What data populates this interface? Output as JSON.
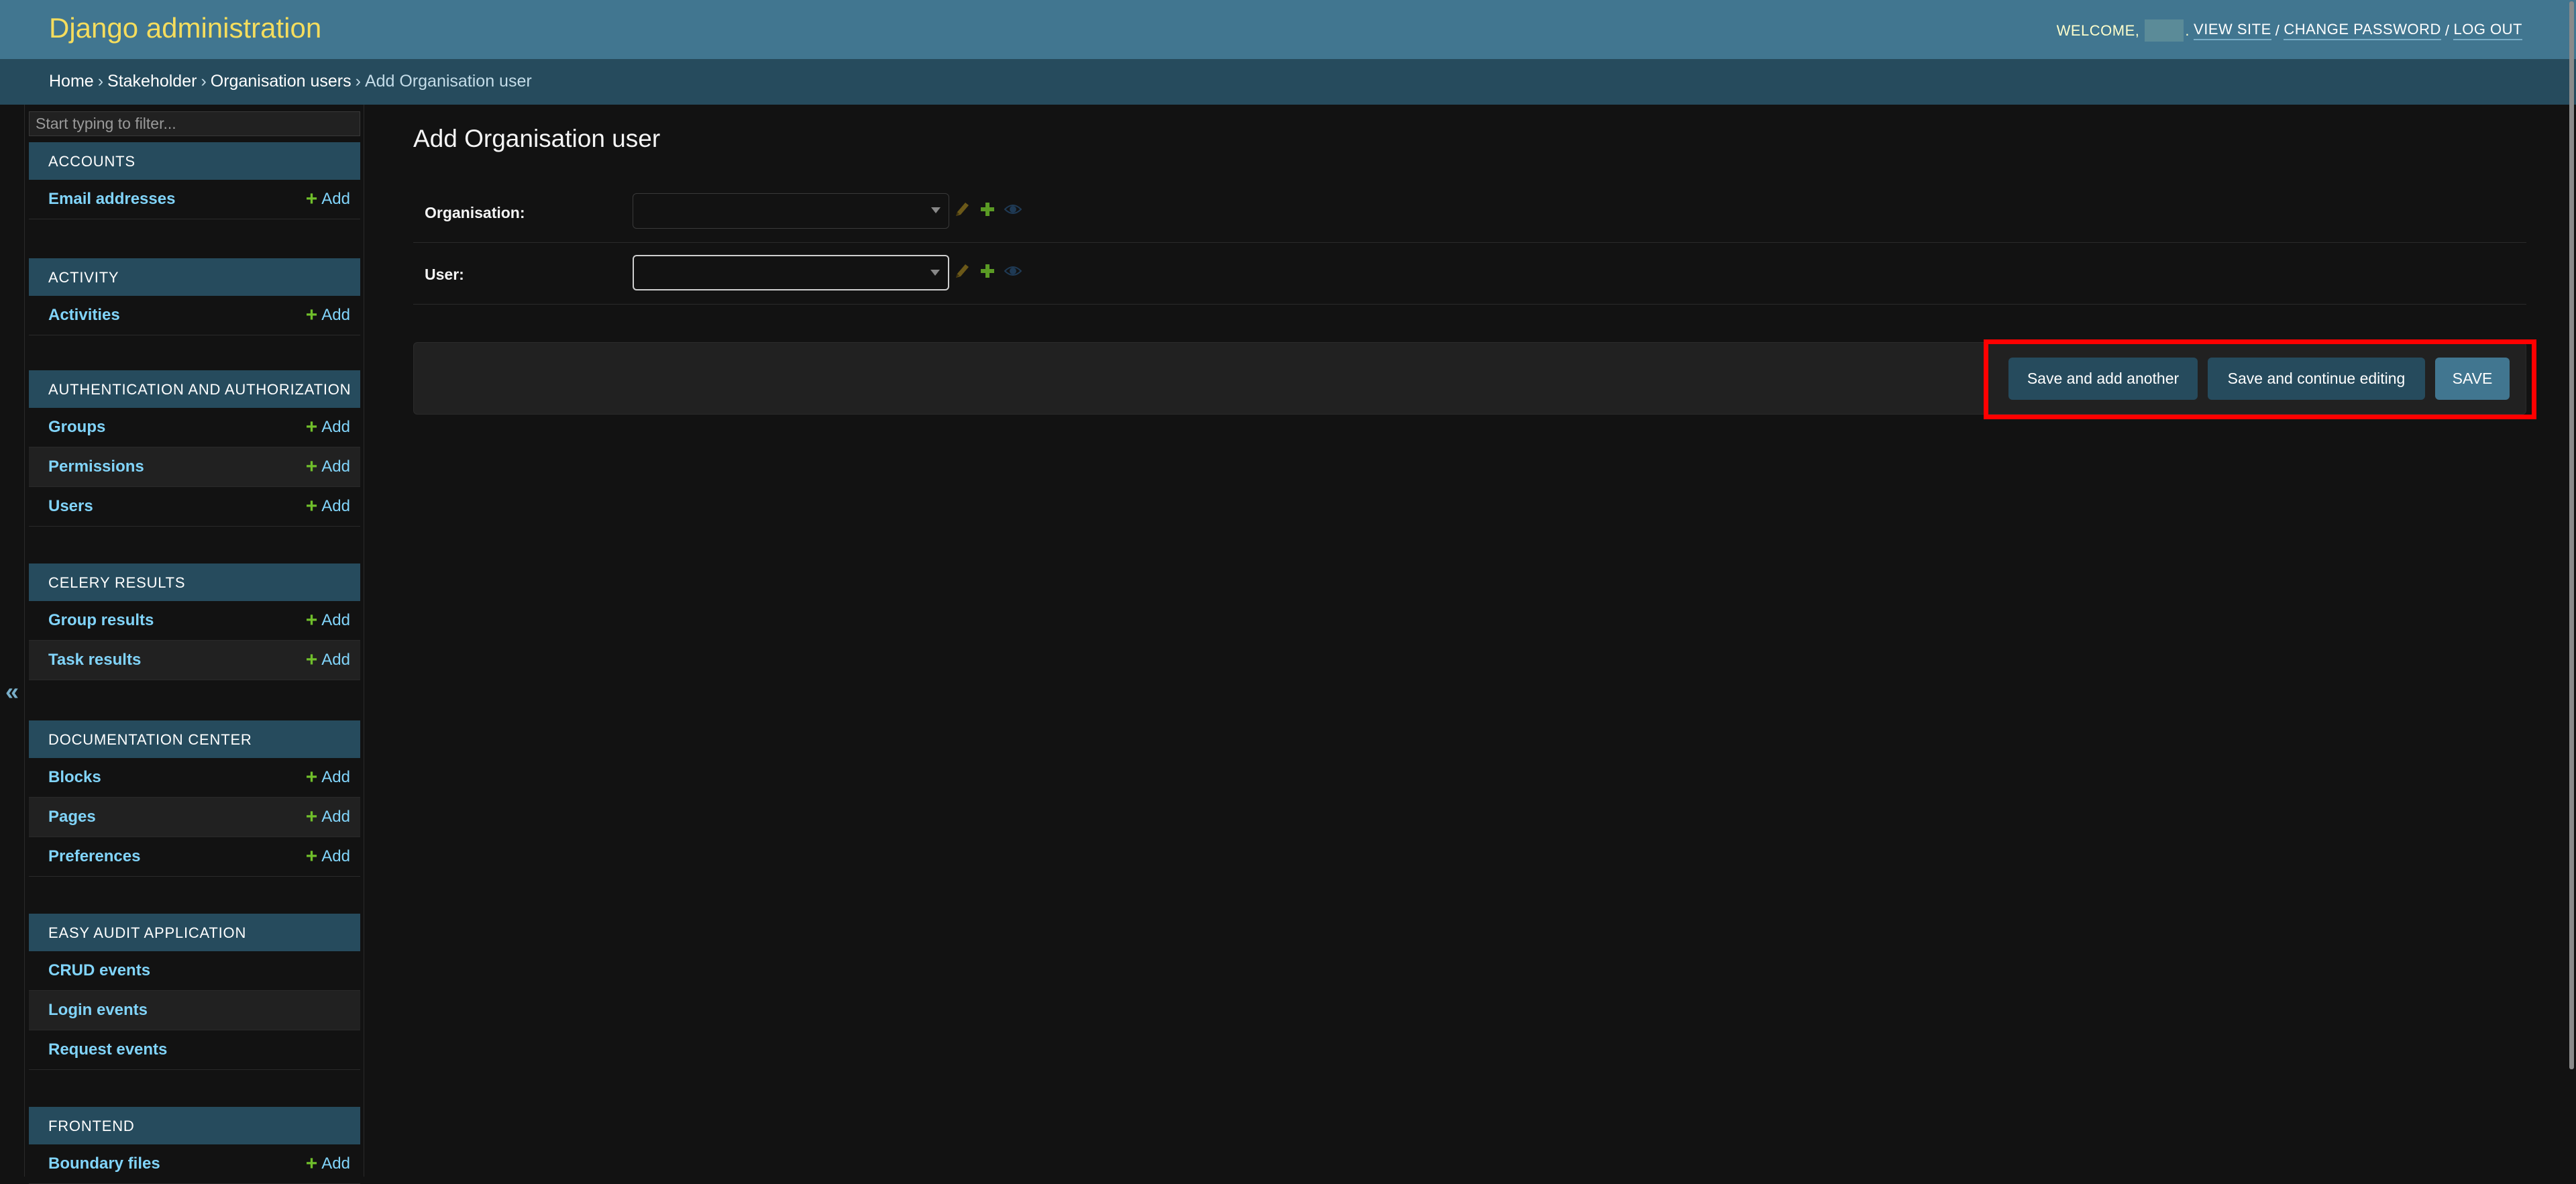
{
  "header": {
    "site_title": "Django administration",
    "welcome": "WELCOME,",
    "username_redacted": "",
    "view_site": "VIEW SITE",
    "change_password": "CHANGE PASSWORD",
    "log_out": "LOG OUT",
    "sep": "/"
  },
  "breadcrumbs": {
    "items": [
      "Home",
      "Stakeholder",
      "Organisation users",
      "Add Organisation user"
    ],
    "sep": "›"
  },
  "sidebar": {
    "filter_placeholder": "Start typing to filter...",
    "toggle_icon": "«",
    "add_label": "Add",
    "modules": [
      {
        "caption": "ACCOUNTS",
        "models": [
          {
            "name": "Email addresses",
            "add": true
          }
        ]
      },
      {
        "caption": "ACTIVITY",
        "models": [
          {
            "name": "Activities",
            "add": true
          }
        ]
      },
      {
        "caption": "AUTHENTICATION AND AUTHORIZATION",
        "models": [
          {
            "name": "Groups",
            "add": true
          },
          {
            "name": "Permissions",
            "add": true
          },
          {
            "name": "Users",
            "add": true
          }
        ]
      },
      {
        "caption": "CELERY RESULTS",
        "models": [
          {
            "name": "Group results",
            "add": true
          },
          {
            "name": "Task results",
            "add": true
          }
        ]
      },
      {
        "caption": "DOCUMENTATION CENTER",
        "models": [
          {
            "name": "Blocks",
            "add": true
          },
          {
            "name": "Pages",
            "add": true
          },
          {
            "name": "Preferences",
            "add": true
          }
        ]
      },
      {
        "caption": "EASY AUDIT APPLICATION",
        "models": [
          {
            "name": "CRUD events",
            "add": false
          },
          {
            "name": "Login events",
            "add": false
          },
          {
            "name": "Request events",
            "add": false
          }
        ]
      },
      {
        "caption": "FRONTEND",
        "models": [
          {
            "name": "Boundary files",
            "add": true
          }
        ]
      }
    ]
  },
  "content": {
    "title": "Add Organisation user",
    "fields": [
      {
        "label": "Organisation:",
        "value": "",
        "focused": false
      },
      {
        "label": "User:",
        "value": "",
        "focused": true
      }
    ],
    "buttons": {
      "save_add_another": "Save and add another",
      "save_continue": "Save and continue editing",
      "save": "Save"
    }
  },
  "colors": {
    "header_bg": "#417690",
    "breadcrumb_bg": "#264b5d",
    "accent_yellow": "#f5dd5d",
    "link_blue": "#81d4fa",
    "add_green": "#70bf2b",
    "highlight_red": "#ff0000"
  }
}
